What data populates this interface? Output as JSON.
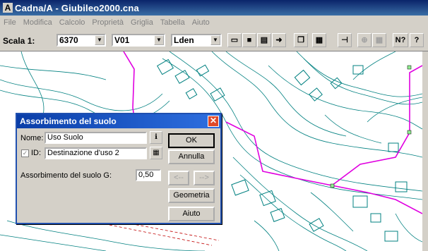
{
  "window": {
    "title": "Cadna/A - Giubileo2000.cna",
    "app_icon": "A"
  },
  "menu": [
    "File",
    "Modifica",
    "Calcolo",
    "Proprietà",
    "Griglia",
    "Tabella",
    "Aiuto"
  ],
  "toolbar": {
    "scale_label": "Scala 1:",
    "scale_value": "6370",
    "variant_value": "V01",
    "metric_value": "Lden",
    "icons": [
      "open-icon",
      "save-icon",
      "print-icon",
      "arrow-right-icon",
      "copy-icon",
      "calculator-icon",
      "pin-icon",
      "zoom-icon",
      "grid-icon",
      "help-pointer-icon",
      "help-icon"
    ],
    "help_pointer_glyph": "N?",
    "help_glyph": "?"
  },
  "dialog": {
    "title": "Assorbimento del suolo",
    "name_label": "Nome:",
    "name_value": "Uso Suolo",
    "id_label": "ID:",
    "id_value": "Destinazione d'uso 2",
    "id_checked": true,
    "g_label": "Assorbimento del suolo G:",
    "g_value": "0,50",
    "buttons": {
      "ok": "OK",
      "cancel": "Annulla",
      "prev": "<--",
      "next": "-->",
      "geometry": "Geometria",
      "help": "Aiuto"
    }
  },
  "colors": {
    "map_lines": "#008080",
    "path": "#e000e0",
    "title_bar": "#0a246a",
    "dialog_border": "#2050b0"
  }
}
